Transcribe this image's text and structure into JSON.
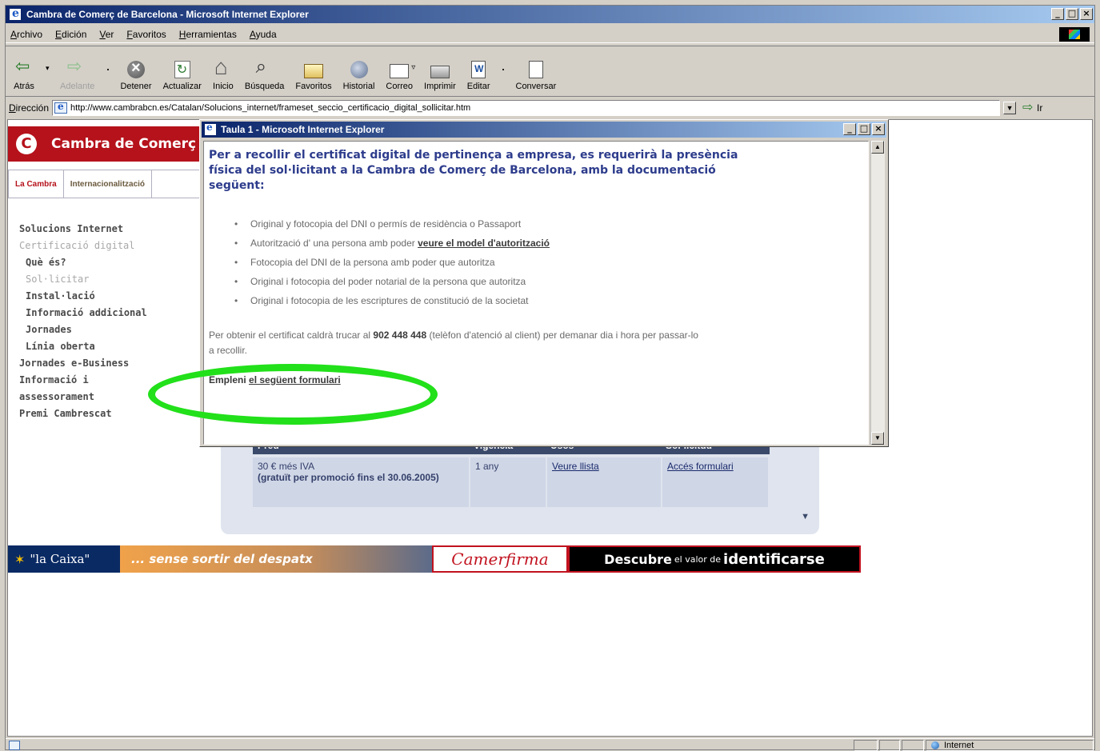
{
  "window": {
    "title": "Cambra de Comerç de Barcelona - Microsoft Internet Explorer",
    "buttons": [
      "_",
      "□",
      "×"
    ]
  },
  "menu": [
    "Archivo",
    "Edición",
    "Ver",
    "Favoritos",
    "Herramientas",
    "Ayuda"
  ],
  "toolbar": {
    "back": "Atrás",
    "forward": "Adelante",
    "stop": "Detener",
    "refresh": "Actualizar",
    "home": "Inicio",
    "search": "Búsqueda",
    "favorites": "Favoritos",
    "history": "Historial",
    "mail": "Correo",
    "print": "Imprimir",
    "edit": "Editar",
    "discuss": "Conversar"
  },
  "address": {
    "label": "Dirección",
    "url": "http://www.cambrabcn.es/Catalan/Solucions_internet/frameset_seccio_certificacio_digital_sollicitar.htm",
    "go": "Ir"
  },
  "site": {
    "logo_letter": "C",
    "title": "Cambra de Comerç",
    "tabs": [
      "La Cambra",
      "Internacionalització"
    ],
    "nav": [
      {
        "label": "Solucions Internet",
        "level": 0,
        "muted": false
      },
      {
        "label": "Certificació digital",
        "level": 0,
        "muted": true
      },
      {
        "label": "Què és?",
        "level": 1,
        "muted": false
      },
      {
        "label": "Sol·licitar",
        "level": 1,
        "muted": true
      },
      {
        "label": "Instal·lació",
        "level": 1,
        "muted": false
      },
      {
        "label": "Informació addicional",
        "level": 1,
        "muted": false
      },
      {
        "label": "Jornades",
        "level": 1,
        "muted": false
      },
      {
        "label": "Línia oberta",
        "level": 1,
        "muted": false
      },
      {
        "label": "Jornades e-Business",
        "level": 0,
        "muted": false
      },
      {
        "label": "Informació i",
        "level": 0,
        "muted": false
      },
      {
        "label": "assessorament",
        "level": 0,
        "muted": false
      },
      {
        "label": "Premi Cambrescat",
        "level": 0,
        "muted": false
      }
    ],
    "table": {
      "headers": [
        "Preu",
        "Vigència",
        "Usos",
        "Sol·licitud"
      ],
      "row": {
        "price": "30 € més IVA",
        "price_note": "(gratuït per promoció fins el 30.06.2005)",
        "validity": "1 any",
        "uses": "Veure llista",
        "request": "Accés formulari"
      }
    },
    "banner": {
      "caixa": "\"la Caixa\"",
      "slogan": "... sense sortir del despatx",
      "camerfirma": "Camerfirma",
      "descubre": "Descubre",
      "el_valor": "el valor de",
      "identificarse": "identificarse"
    }
  },
  "popup": {
    "title": "Taula 1 - Microsoft Internet Explorer",
    "heading": "Per a recollir el certificat digital de pertinença a empresa, es requerirà la presència física del sol·licitant a la Cambra de Comerç de Barcelona, amb la documentació següent:",
    "items": [
      {
        "text": "Original y fotocopia del DNI o permís de residència o Passaport",
        "link": ""
      },
      {
        "text": "Autorització d' una persona amb poder ",
        "link": "veure el model d'autorització"
      },
      {
        "text": "Fotocopia del DNI de la persona amb poder que autoritza",
        "link": ""
      },
      {
        "text": "Original i fotocopia del poder notarial de la persona que autoritza",
        "link": ""
      },
      {
        "text": "Original i fotocopia de les escriptures de constitució de la societat",
        "link": ""
      }
    ],
    "para_before": "Per obtenir el certificat caldrà trucar al ",
    "phone": "902 448 448",
    "para_after": " (telèfon d'atenció al client) per demanar dia i hora per passar-lo a recollir.",
    "form_prefix": "Empleni ",
    "form_link": "el següent formulari"
  },
  "status": {
    "zone": "Internet"
  }
}
